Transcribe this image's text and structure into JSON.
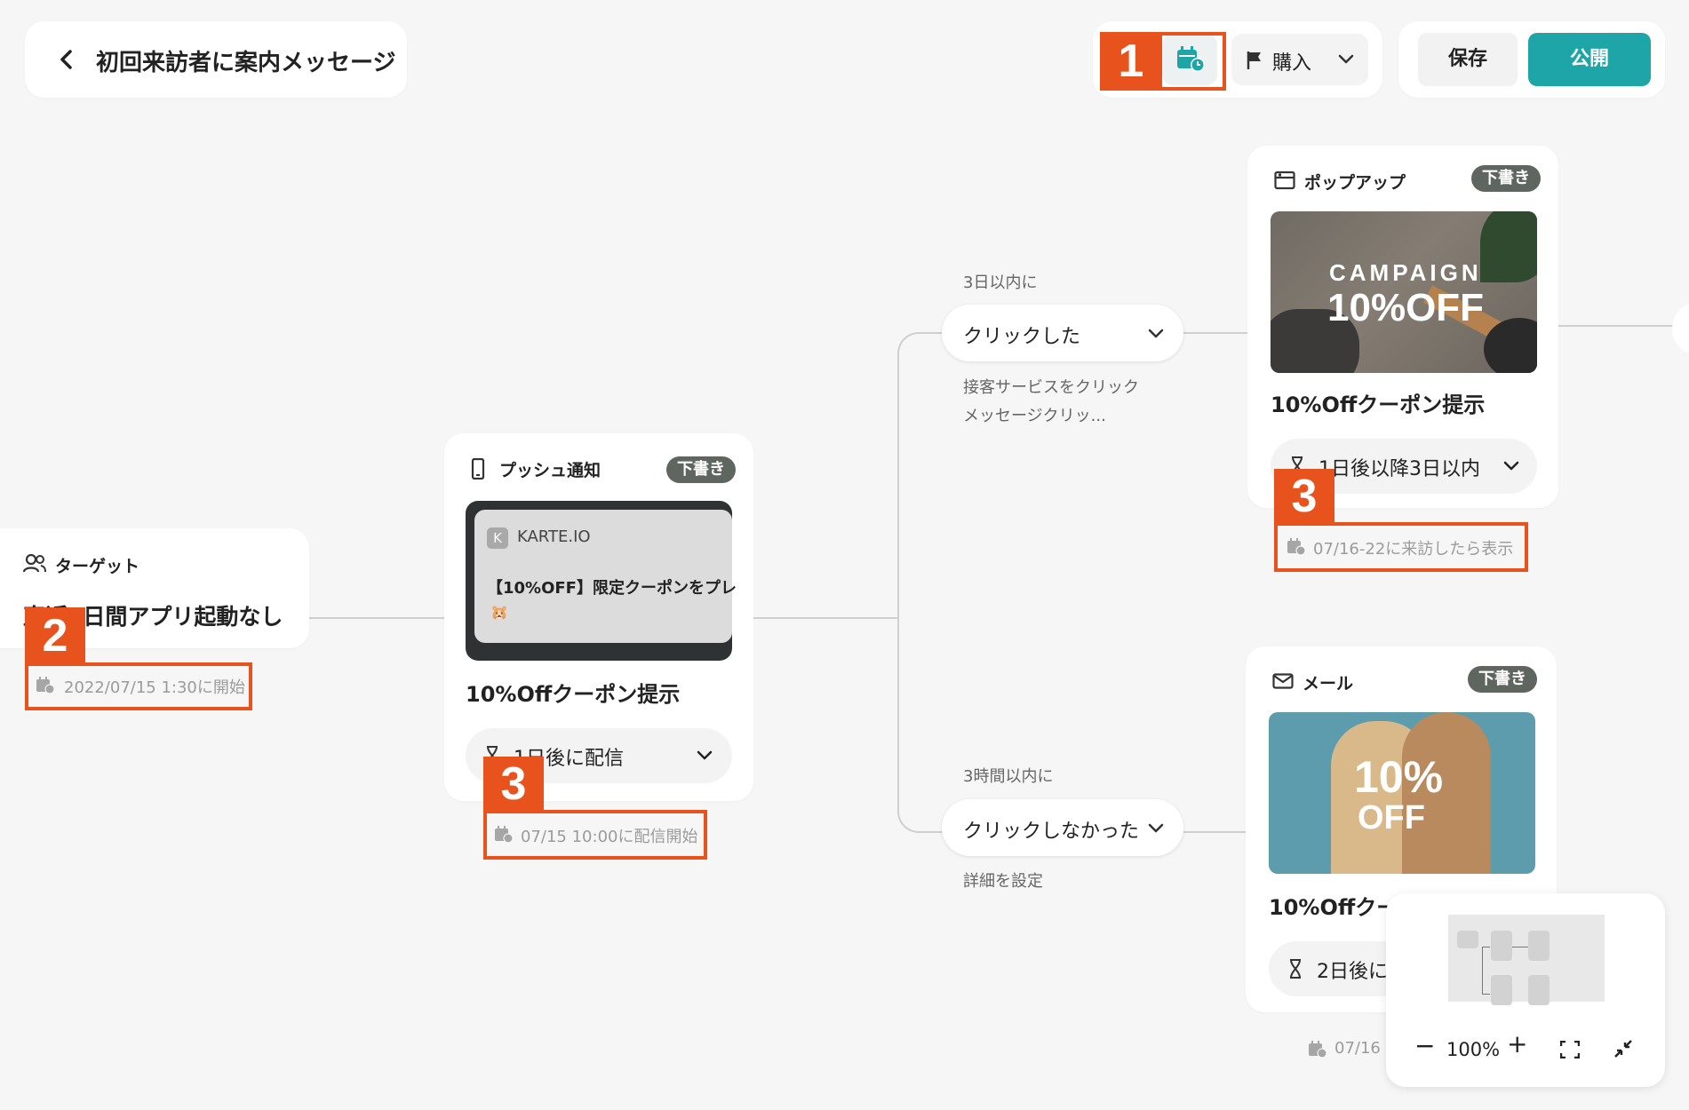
{
  "header": {
    "title": "初回来訪者に案内メッセージ",
    "goal_label": "購入",
    "save_label": "保存",
    "publish_label": "公開"
  },
  "annotations": {
    "badge1": "1",
    "badge2": "2",
    "badge3": "3"
  },
  "target": {
    "type_label": "ターゲット",
    "title": "直近7日間アプリ起動なし",
    "schedule": "2022/07/15 1:30に開始"
  },
  "push": {
    "type_label": "プッシュ通知",
    "status": "下書き",
    "app_initial": "K",
    "app_name": "KARTE.IO",
    "message": "【10%OFF】限定クーポンをプレ",
    "emoji": "🐹",
    "title": "10%Offクーポン提示",
    "delay": "1日後に配信",
    "schedule": "07/15 10:00に配信開始"
  },
  "branch_top": {
    "caption": "3日以内に",
    "condition": "クリックした",
    "desc_line1": "接客サービスをクリック",
    "desc_line2": "メッセージクリッ..."
  },
  "branch_bottom": {
    "caption": "3時間以内に",
    "condition": "クリックしなかった",
    "desc": "詳細を設定"
  },
  "popup": {
    "type_label": "ポップアップ",
    "status": "下書き",
    "image_text1": "CAMPAIGN",
    "image_text2": "10%OFF",
    "title": "10%Offクーポン提示",
    "delay": "1日後以降3日以内",
    "schedule": "07/16-22に来訪したら表示"
  },
  "mail": {
    "type_label": "メール",
    "status": "下書き",
    "image_text1": "10%",
    "image_text2": "OFF",
    "title": "10%Offクー",
    "delay": "2日後に",
    "schedule": "07/16"
  },
  "zoom": {
    "level": "100%"
  },
  "colors": {
    "accent": "#1ea5a8",
    "annotation": "#e8531d",
    "draft_badge": "#5f6660"
  }
}
